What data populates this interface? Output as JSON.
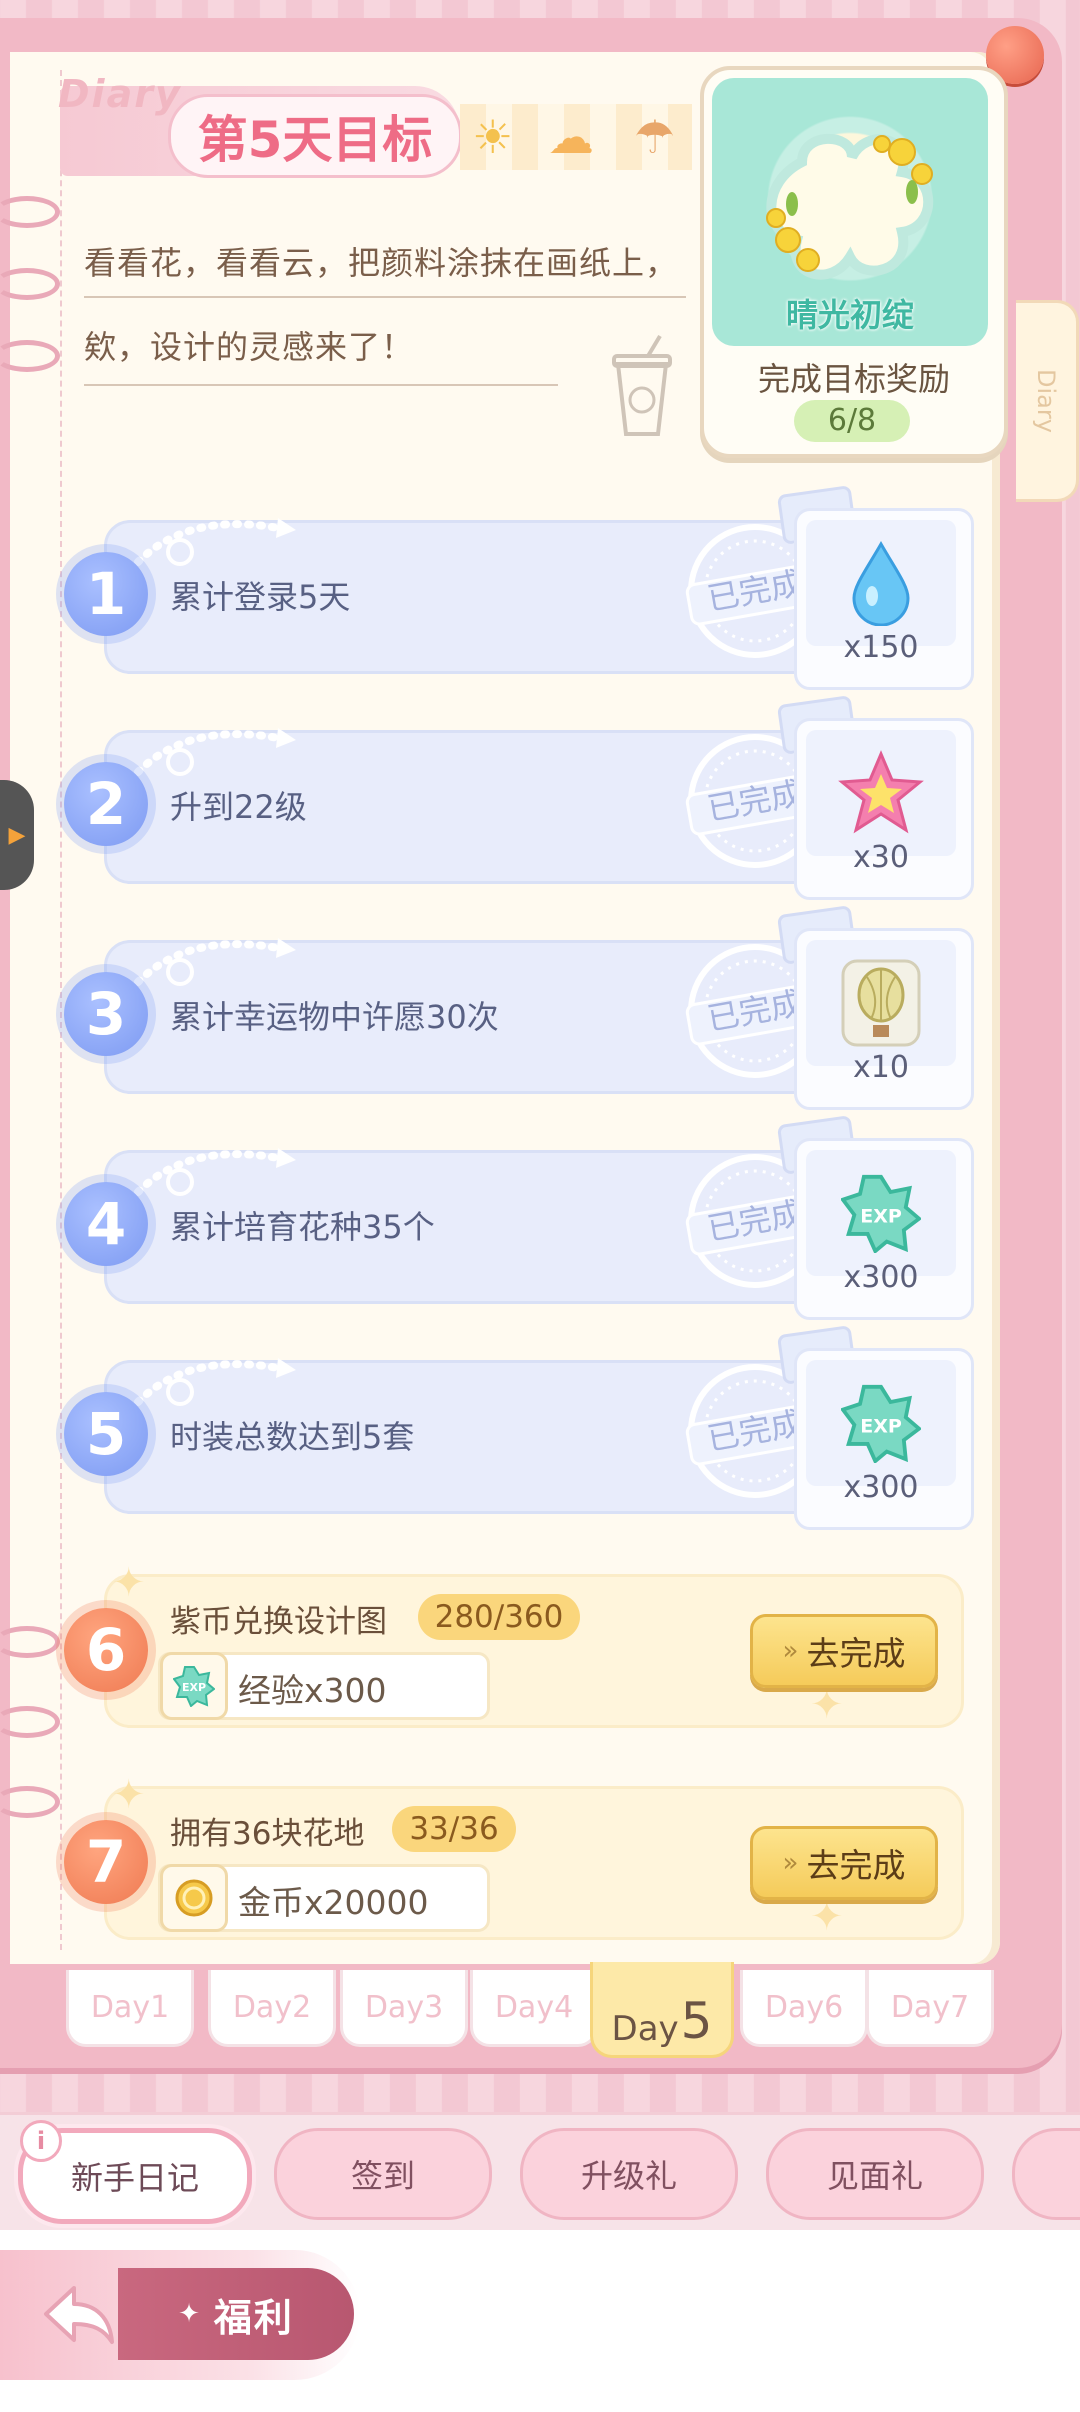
{
  "header": {
    "diary_script": "Diary",
    "title": "第5天目标",
    "weather_icons": [
      "sun-icon",
      "cloud-icon",
      "rain-cloud-icon"
    ]
  },
  "intro": {
    "line1": "看看花，看看云，把颜料涂抹在画纸上，",
    "line2": "欸，设计的灵感来了！"
  },
  "side_tab": "Diary",
  "goal_reward": {
    "name": "晴光初绽",
    "caption": "完成目标奖励",
    "progress": "6/8"
  },
  "tasks": [
    {
      "num": "1",
      "label": "累计登录5天",
      "status": "已完成",
      "reward_icon": "water-drop-icon",
      "reward_qty": "x150"
    },
    {
      "num": "2",
      "label": "升到22级",
      "status": "已完成",
      "reward_icon": "pink-star-icon",
      "reward_qty": "x30"
    },
    {
      "num": "3",
      "label": "累计幸运物中许愿30次",
      "status": "已完成",
      "reward_icon": "hot-air-balloon-icon",
      "reward_qty": "x10"
    },
    {
      "num": "4",
      "label": "累计培育花种35个",
      "status": "已完成",
      "reward_icon": "exp-badge-icon",
      "reward_qty": "x300"
    },
    {
      "num": "5",
      "label": "时装总数达到5套",
      "status": "已完成",
      "reward_icon": "exp-badge-icon",
      "reward_qty": "x300"
    }
  ],
  "pending_tasks": [
    {
      "num": "6",
      "label": "紫币兑换设计图",
      "progress": "280/360",
      "reward_icon": "exp-badge-icon",
      "reward_text": "经验x300",
      "button": "去完成"
    },
    {
      "num": "7",
      "label": "拥有36块花地",
      "progress": "33/36",
      "reward_icon": "gold-coin-icon",
      "reward_text": "金币x20000",
      "button": "去完成"
    }
  ],
  "day_tabs": {
    "days": [
      "Day1",
      "Day2",
      "Day3",
      "Day4",
      "Day6",
      "Day7"
    ],
    "active_prefix": "Day",
    "active_num": "5"
  },
  "nav": {
    "info": "i",
    "items": [
      "新手日记",
      "签到",
      "升级礼",
      "见面礼"
    ]
  },
  "welfare_label": "福利",
  "colors": {
    "accent_pink": "#ee6c86",
    "task_blue": "#7d9af2",
    "task_orange": "#ef7a52",
    "button_yellow": "#f5cb5a"
  }
}
